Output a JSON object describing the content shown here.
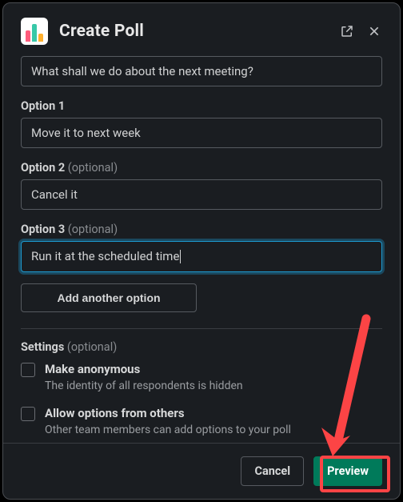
{
  "header": {
    "title": "Create Poll"
  },
  "question": {
    "value": "What shall we do about the next meeting?"
  },
  "options": [
    {
      "label": "Option 1",
      "optional": "",
      "value": "Move it to next week",
      "focused": false
    },
    {
      "label": "Option 2",
      "optional": "(optional)",
      "value": "Cancel it",
      "focused": false
    },
    {
      "label": "Option 3",
      "optional": "(optional)",
      "value": "Run it at the scheduled time",
      "focused": true
    }
  ],
  "add_option_label": "Add another option",
  "settings": {
    "label": "Settings",
    "optional": "(optional)",
    "items": [
      {
        "title": "Make anonymous",
        "desc": "The identity of all respondents is hidden"
      },
      {
        "title": "Allow options from others",
        "desc": "Other team members can add options to your poll"
      }
    ]
  },
  "footer": {
    "cancel": "Cancel",
    "preview": "Preview"
  },
  "annotation": {
    "arrow_color": "#fc4445",
    "highlight_target": "preview-button"
  }
}
